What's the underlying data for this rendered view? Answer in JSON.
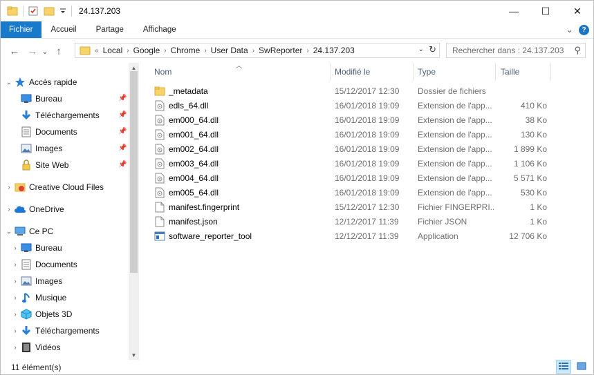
{
  "window": {
    "title": "24.137.203",
    "minimize": "—",
    "maximize": "☐",
    "close": "✕"
  },
  "ribbon": {
    "tabs": [
      "Fichier",
      "Accueil",
      "Partage",
      "Affichage"
    ],
    "collapse": "⌄",
    "help": "?"
  },
  "nav": {
    "back": "←",
    "forward": "→",
    "recent": "⌄",
    "up": "↑",
    "overflow": "«",
    "breadcrumb": [
      "Local",
      "Google",
      "Chrome",
      "User Data",
      "SwReporter",
      "24.137.203"
    ],
    "search_placeholder": "Rechercher dans : 24.137.203"
  },
  "sidebar": {
    "items": [
      {
        "label": "Accès rapide",
        "icon": "star-icon"
      },
      {
        "label": "Bureau",
        "icon": "desktop-icon"
      },
      {
        "label": "Téléchargements",
        "icon": "download-icon"
      },
      {
        "label": "Documents",
        "icon": "documents-icon"
      },
      {
        "label": "Images",
        "icon": "images-icon"
      },
      {
        "label": "Site Web",
        "icon": "lock-folder-icon"
      },
      {
        "label": "Creative Cloud Files",
        "icon": "creative-cloud-folder-icon"
      },
      {
        "label": "OneDrive",
        "icon": "onedrive-cloud-icon"
      },
      {
        "label": "Ce PC",
        "icon": "computer-icon"
      },
      {
        "label": "Bureau",
        "icon": "desktop-icon"
      },
      {
        "label": "Documents",
        "icon": "documents-icon"
      },
      {
        "label": "Images",
        "icon": "images-icon"
      },
      {
        "label": "Musique",
        "icon": "music-icon"
      },
      {
        "label": "Objets 3D",
        "icon": "cube-icon"
      },
      {
        "label": "Téléchargements",
        "icon": "download-icon"
      },
      {
        "label": "Vidéos",
        "icon": "video-icon"
      }
    ]
  },
  "columns": {
    "name": "Nom",
    "modified": "Modifié le",
    "type": "Type",
    "size": "Taille"
  },
  "files": [
    {
      "name": "_metadata",
      "date": "15/12/2017 12:30",
      "type": "Dossier de fichiers",
      "size": "",
      "icon": "folder-icon"
    },
    {
      "name": "edls_64.dll",
      "date": "16/01/2018 19:09",
      "type": "Extension de l'app...",
      "size": "410 Ko",
      "icon": "dll-file-icon"
    },
    {
      "name": "em000_64.dll",
      "date": "16/01/2018 19:09",
      "type": "Extension de l'app...",
      "size": "38 Ko",
      "icon": "dll-file-icon"
    },
    {
      "name": "em001_64.dll",
      "date": "16/01/2018 19:09",
      "type": "Extension de l'app...",
      "size": "130 Ko",
      "icon": "dll-file-icon"
    },
    {
      "name": "em002_64.dll",
      "date": "16/01/2018 19:09",
      "type": "Extension de l'app...",
      "size": "1 899 Ko",
      "icon": "dll-file-icon"
    },
    {
      "name": "em003_64.dll",
      "date": "16/01/2018 19:09",
      "type": "Extension de l'app...",
      "size": "1 106 Ko",
      "icon": "dll-file-icon"
    },
    {
      "name": "em004_64.dll",
      "date": "16/01/2018 19:09",
      "type": "Extension de l'app...",
      "size": "5 571 Ko",
      "icon": "dll-file-icon"
    },
    {
      "name": "em005_64.dll",
      "date": "16/01/2018 19:09",
      "type": "Extension de l'app...",
      "size": "530 Ko",
      "icon": "dll-file-icon"
    },
    {
      "name": "manifest.fingerprint",
      "date": "15/12/2017 12:30",
      "type": "Fichier FINGERPRI...",
      "size": "1 Ko",
      "icon": "blank-file-icon"
    },
    {
      "name": "manifest.json",
      "date": "12/12/2017 11:39",
      "type": "Fichier JSON",
      "size": "1 Ko",
      "icon": "blank-file-icon"
    },
    {
      "name": "software_reporter_tool",
      "date": "12/12/2017 11:39",
      "type": "Application",
      "size": "12 706 Ko",
      "icon": "application-icon"
    }
  ],
  "status": {
    "count": "11 élément(s)"
  },
  "colors": {
    "accent": "#1979ca",
    "folder": "#f6d36b",
    "header_text": "#4c607a",
    "secondary_text": "#6d6d6d"
  }
}
